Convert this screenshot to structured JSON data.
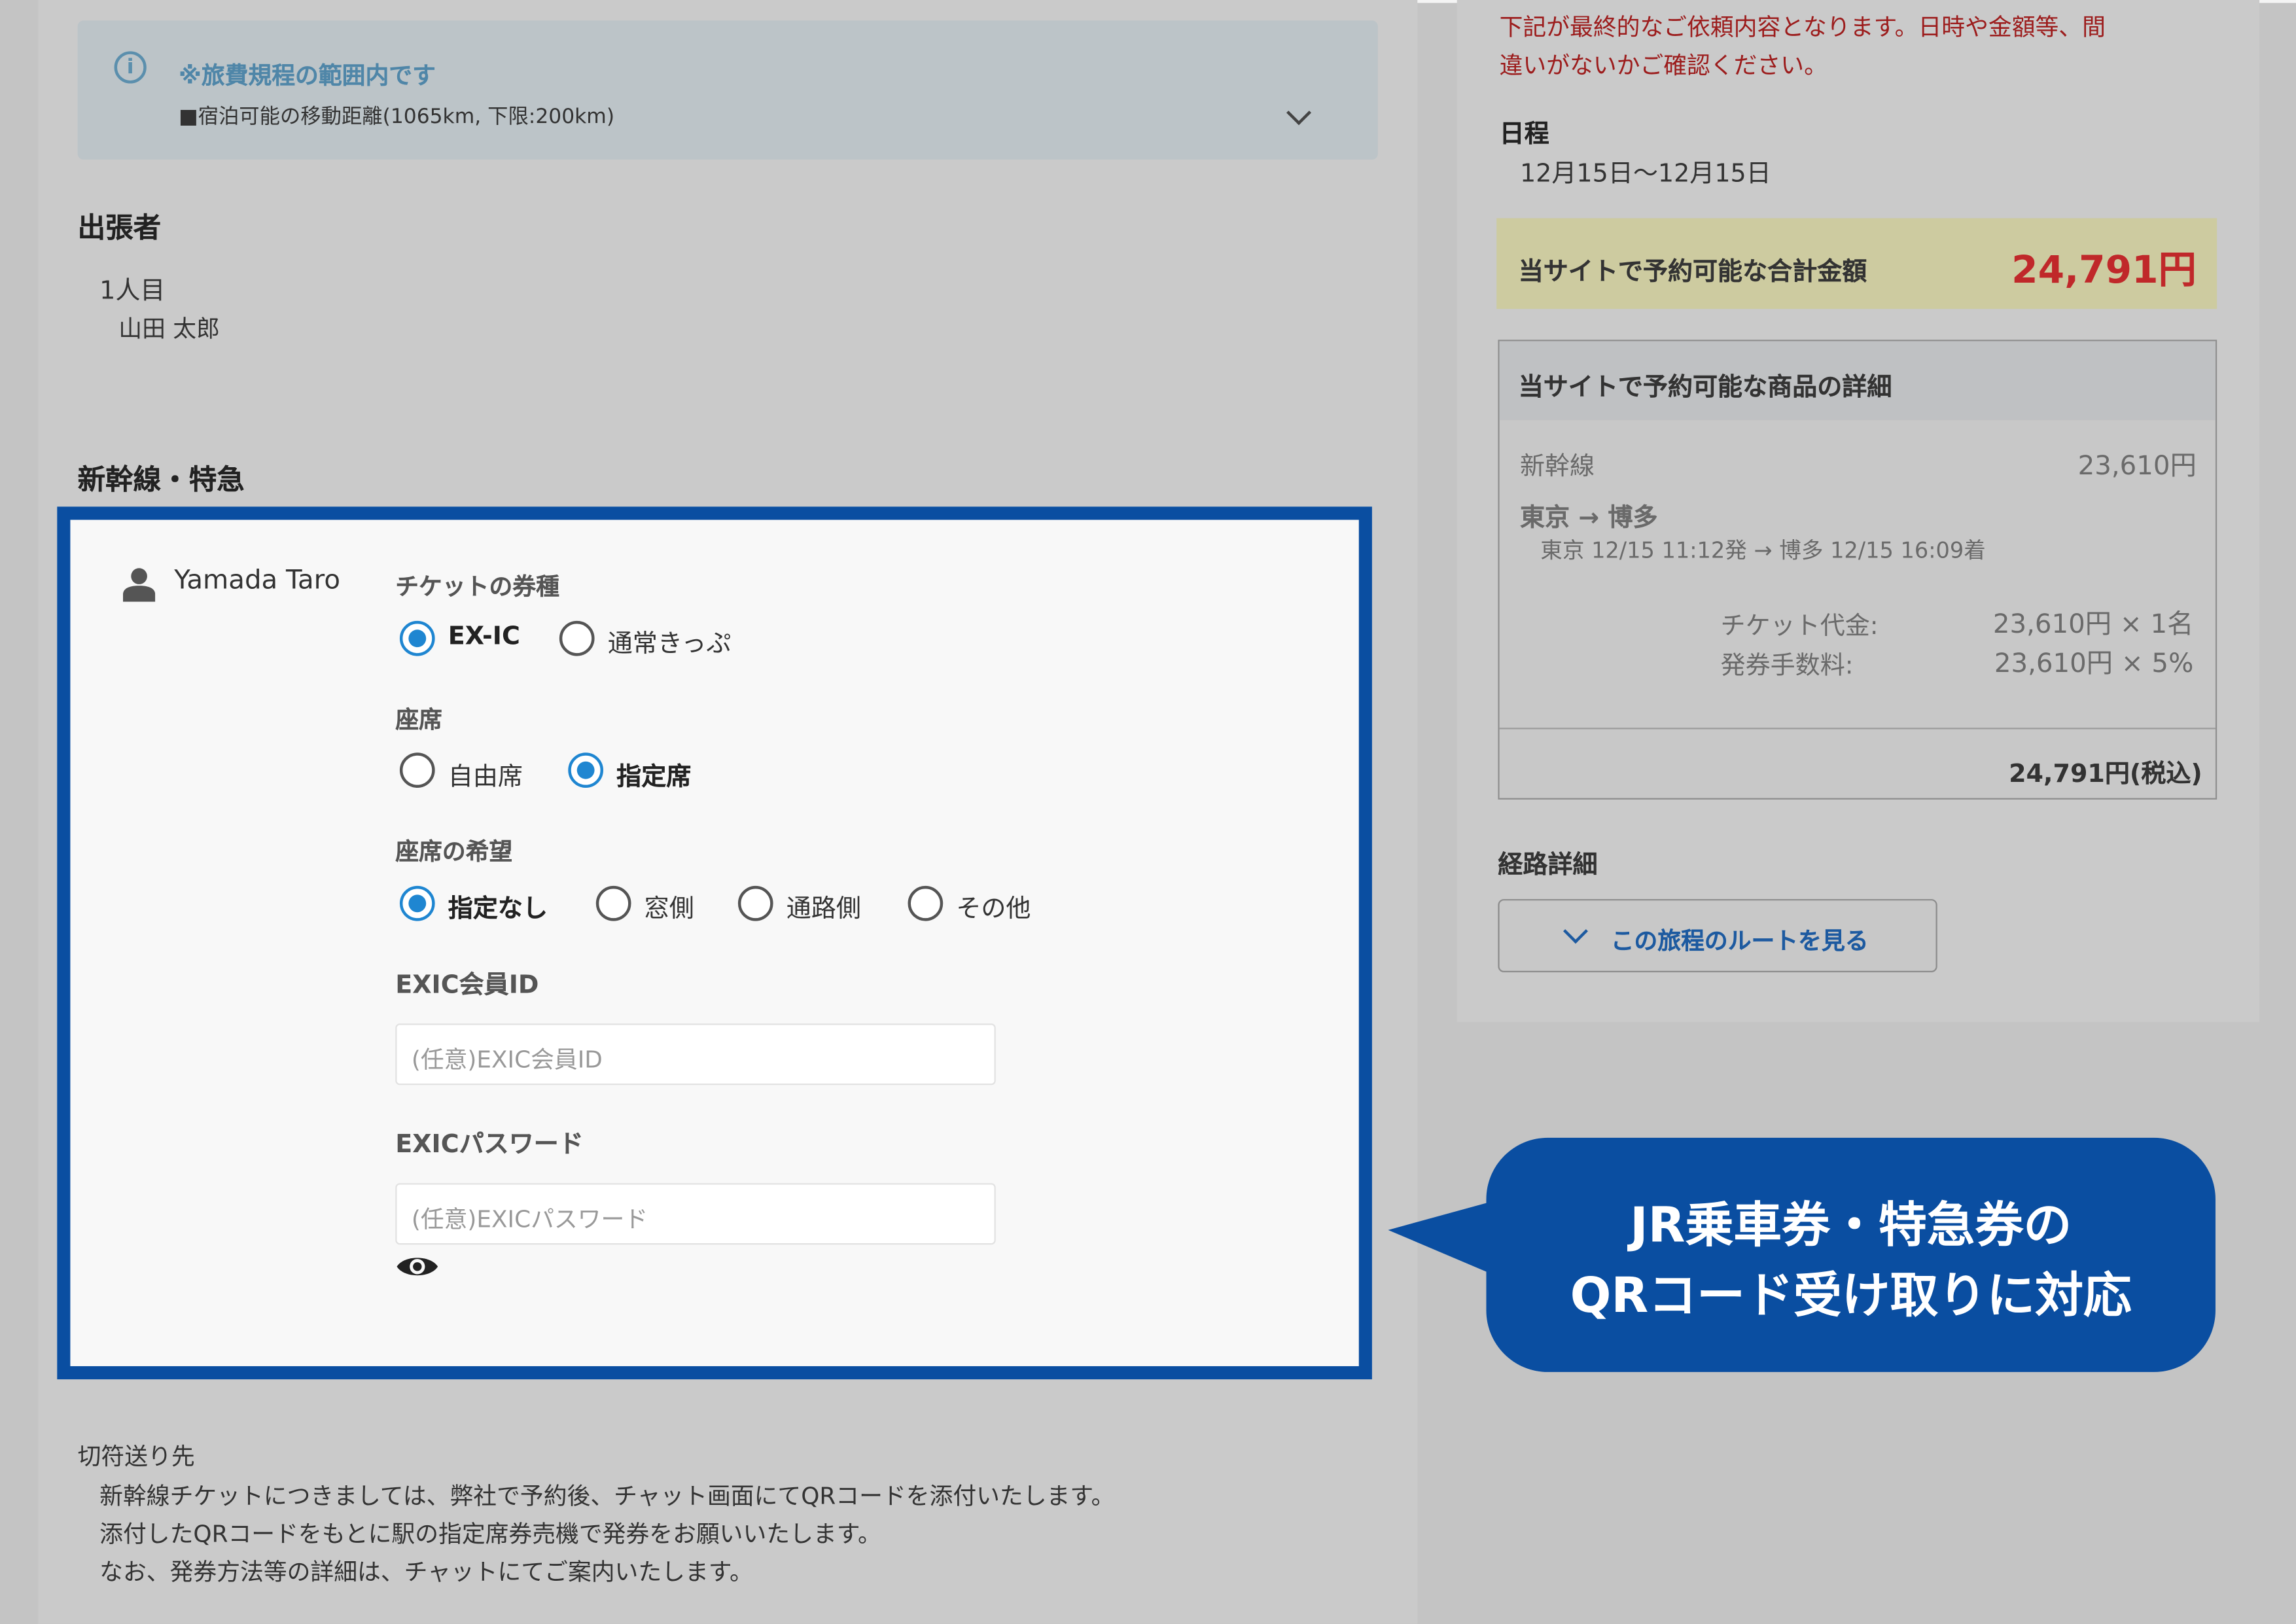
{
  "notice": {
    "icon": "info-circle-icon",
    "title": "※旅費規程の範囲内です",
    "detail": "■宿泊可能の移動距離(1065km, 下限:200km)"
  },
  "traveler_section": {
    "title": "出張者",
    "index": "1人目",
    "name": "山田 太郎"
  },
  "train_section": {
    "title": "新幹線・特急",
    "passenger": "Yamada Taro",
    "ticket_type": {
      "label": "チケットの券種",
      "options": [
        "EX-IC",
        "通常きっぷ"
      ],
      "selected": "EX-IC"
    },
    "seat": {
      "label": "座席",
      "options": [
        "自由席",
        "指定席"
      ],
      "selected": "指定席"
    },
    "seat_pref": {
      "label": "座席の希望",
      "options": [
        "指定なし",
        "窓側",
        "通路側",
        "その他"
      ],
      "selected": "指定なし"
    },
    "member_id": {
      "label": "EXIC会員ID",
      "placeholder": "(任意)EXIC会員ID",
      "value": ""
    },
    "password": {
      "label": "EXICパスワード",
      "placeholder": "(任意)EXICパスワード",
      "value": ""
    }
  },
  "delivery": {
    "title": "切符送り先",
    "lines": [
      "新幹線チケットにつきましては、弊社で予約後、チャット画面にてQRコードを添付いたします。",
      "添付したQRコードをもとに駅の指定席券売機で発券をお願いいたします。",
      "なお、発券方法等の詳細は、チャットにてご案内いたします。"
    ]
  },
  "summary": {
    "warning_line1": "下記が最終的なご依頼内容となります。日時や金額等、間",
    "warning_line2": "違いがないかご確認ください。",
    "schedule_label": "日程",
    "schedule_value": "12月15日〜12月15日",
    "total_label": "当サイトで予約可能な合計金額",
    "total_value": "24,791円",
    "detail_title": "当サイトで予約可能な商品の詳細",
    "item_name": "新幹線",
    "item_price": "23,610円",
    "route_main": "東京 → 博多",
    "route_sub": "東京 12/15 11:12発 → 博多 12/15 16:09着",
    "ticket_fee_label": "チケット代金:",
    "ticket_fee_value": "23,610円 × 1名",
    "issue_fee_label": "発券手数料:",
    "issue_fee_value": "23,610円 × 5%",
    "grand_total": "24,791円(税込)",
    "route_detail_label": "経路詳細",
    "route_button": "この旅程のルートを見る"
  },
  "callout": {
    "line1": "JR乗車券・特急券の",
    "line2": "QRコード受け取りに対応"
  },
  "colors": {
    "accent_blue": "#0a4ea1",
    "radio_blue": "#1f86d1",
    "total_red": "#c0282a",
    "warning_red": "#9c1c1c"
  }
}
